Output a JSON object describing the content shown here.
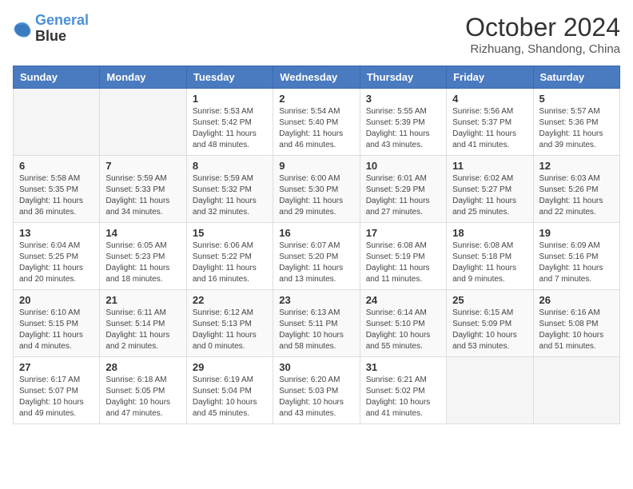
{
  "header": {
    "logo_line1": "General",
    "logo_line2": "Blue",
    "month_title": "October 2024",
    "location": "Rizhuang, Shandong, China"
  },
  "weekdays": [
    "Sunday",
    "Monday",
    "Tuesday",
    "Wednesday",
    "Thursday",
    "Friday",
    "Saturday"
  ],
  "weeks": [
    [
      {
        "day": "",
        "info": ""
      },
      {
        "day": "",
        "info": ""
      },
      {
        "day": "1",
        "info": "Sunrise: 5:53 AM\nSunset: 5:42 PM\nDaylight: 11 hours and 48 minutes."
      },
      {
        "day": "2",
        "info": "Sunrise: 5:54 AM\nSunset: 5:40 PM\nDaylight: 11 hours and 46 minutes."
      },
      {
        "day": "3",
        "info": "Sunrise: 5:55 AM\nSunset: 5:39 PM\nDaylight: 11 hours and 43 minutes."
      },
      {
        "day": "4",
        "info": "Sunrise: 5:56 AM\nSunset: 5:37 PM\nDaylight: 11 hours and 41 minutes."
      },
      {
        "day": "5",
        "info": "Sunrise: 5:57 AM\nSunset: 5:36 PM\nDaylight: 11 hours and 39 minutes."
      }
    ],
    [
      {
        "day": "6",
        "info": "Sunrise: 5:58 AM\nSunset: 5:35 PM\nDaylight: 11 hours and 36 minutes."
      },
      {
        "day": "7",
        "info": "Sunrise: 5:59 AM\nSunset: 5:33 PM\nDaylight: 11 hours and 34 minutes."
      },
      {
        "day": "8",
        "info": "Sunrise: 5:59 AM\nSunset: 5:32 PM\nDaylight: 11 hours and 32 minutes."
      },
      {
        "day": "9",
        "info": "Sunrise: 6:00 AM\nSunset: 5:30 PM\nDaylight: 11 hours and 29 minutes."
      },
      {
        "day": "10",
        "info": "Sunrise: 6:01 AM\nSunset: 5:29 PM\nDaylight: 11 hours and 27 minutes."
      },
      {
        "day": "11",
        "info": "Sunrise: 6:02 AM\nSunset: 5:27 PM\nDaylight: 11 hours and 25 minutes."
      },
      {
        "day": "12",
        "info": "Sunrise: 6:03 AM\nSunset: 5:26 PM\nDaylight: 11 hours and 22 minutes."
      }
    ],
    [
      {
        "day": "13",
        "info": "Sunrise: 6:04 AM\nSunset: 5:25 PM\nDaylight: 11 hours and 20 minutes."
      },
      {
        "day": "14",
        "info": "Sunrise: 6:05 AM\nSunset: 5:23 PM\nDaylight: 11 hours and 18 minutes."
      },
      {
        "day": "15",
        "info": "Sunrise: 6:06 AM\nSunset: 5:22 PM\nDaylight: 11 hours and 16 minutes."
      },
      {
        "day": "16",
        "info": "Sunrise: 6:07 AM\nSunset: 5:20 PM\nDaylight: 11 hours and 13 minutes."
      },
      {
        "day": "17",
        "info": "Sunrise: 6:08 AM\nSunset: 5:19 PM\nDaylight: 11 hours and 11 minutes."
      },
      {
        "day": "18",
        "info": "Sunrise: 6:08 AM\nSunset: 5:18 PM\nDaylight: 11 hours and 9 minutes."
      },
      {
        "day": "19",
        "info": "Sunrise: 6:09 AM\nSunset: 5:16 PM\nDaylight: 11 hours and 7 minutes."
      }
    ],
    [
      {
        "day": "20",
        "info": "Sunrise: 6:10 AM\nSunset: 5:15 PM\nDaylight: 11 hours and 4 minutes."
      },
      {
        "day": "21",
        "info": "Sunrise: 6:11 AM\nSunset: 5:14 PM\nDaylight: 11 hours and 2 minutes."
      },
      {
        "day": "22",
        "info": "Sunrise: 6:12 AM\nSunset: 5:13 PM\nDaylight: 11 hours and 0 minutes."
      },
      {
        "day": "23",
        "info": "Sunrise: 6:13 AM\nSunset: 5:11 PM\nDaylight: 10 hours and 58 minutes."
      },
      {
        "day": "24",
        "info": "Sunrise: 6:14 AM\nSunset: 5:10 PM\nDaylight: 10 hours and 55 minutes."
      },
      {
        "day": "25",
        "info": "Sunrise: 6:15 AM\nSunset: 5:09 PM\nDaylight: 10 hours and 53 minutes."
      },
      {
        "day": "26",
        "info": "Sunrise: 6:16 AM\nSunset: 5:08 PM\nDaylight: 10 hours and 51 minutes."
      }
    ],
    [
      {
        "day": "27",
        "info": "Sunrise: 6:17 AM\nSunset: 5:07 PM\nDaylight: 10 hours and 49 minutes."
      },
      {
        "day": "28",
        "info": "Sunrise: 6:18 AM\nSunset: 5:05 PM\nDaylight: 10 hours and 47 minutes."
      },
      {
        "day": "29",
        "info": "Sunrise: 6:19 AM\nSunset: 5:04 PM\nDaylight: 10 hours and 45 minutes."
      },
      {
        "day": "30",
        "info": "Sunrise: 6:20 AM\nSunset: 5:03 PM\nDaylight: 10 hours and 43 minutes."
      },
      {
        "day": "31",
        "info": "Sunrise: 6:21 AM\nSunset: 5:02 PM\nDaylight: 10 hours and 41 minutes."
      },
      {
        "day": "",
        "info": ""
      },
      {
        "day": "",
        "info": ""
      }
    ]
  ]
}
